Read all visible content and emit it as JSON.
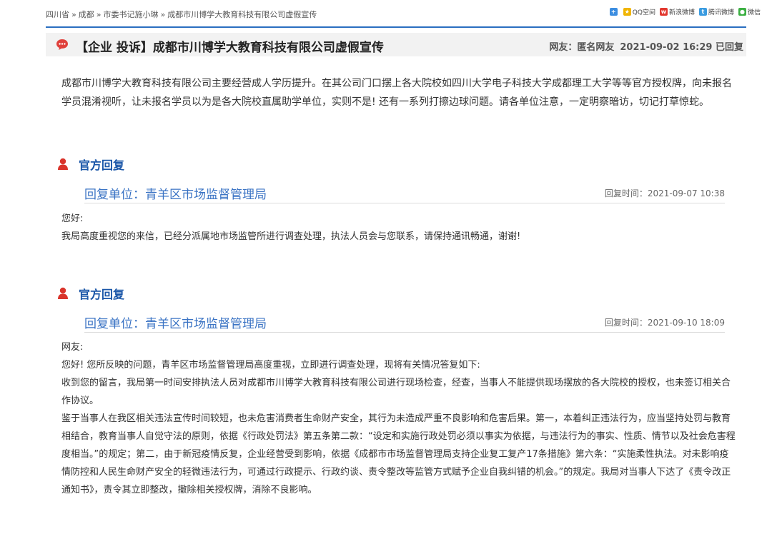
{
  "breadcrumb": [
    "四川省",
    "成都",
    "市委书记施小琳",
    "成都市川博学大教育科技有限公司虚假宣传"
  ],
  "breadcrumb_sep": "»",
  "share": {
    "qzone": "QQ空间",
    "weibo": "新浪微博",
    "tencent": "腾讯微博",
    "wechat": "微信"
  },
  "post": {
    "title": "【企业 投诉】成都市川博学大教育科技有限公司虚假宣传",
    "author": "网友：匿名网友",
    "datetime": "2021-09-02 16:29",
    "status": "已回复",
    "content": "成都市川博学大教育科技有限公司主要经营成人学历提升。在其公司门口摆上各大院校如四川大学电子科技大学成都理工大学等等官方授权牌，向未报名学员混淆视听，让未报名学员以为是各大院校直属助学单位，实则不是! 还有一系列打擦边球问题。请各单位注意，一定明察暗访，切记打草惊蛇。"
  },
  "replies": [
    {
      "heading": "官方回复",
      "unit": "回复单位：青羊区市场监督管理局",
      "time": "回复时间：2021-09-07 10:38",
      "paragraphs": [
        "您好:",
        "我局高度重视您的来信，已经分派属地市场监管所进行调查处理，执法人员会与您联系，请保持通讯畅通，谢谢!"
      ]
    },
    {
      "heading": "官方回复",
      "unit": "回复单位：青羊区市场监督管理局",
      "time": "回复时间：2021-09-10 18:09",
      "paragraphs": [
        "网友:",
        "您好! 您所反映的问题，青羊区市场监督管理局高度重视，立即进行调查处理，现将有关情况答复如下:",
        "收到您的留言，我局第一时间安排执法人员对成都市川博学大教育科技有限公司进行现场检查，经查，当事人不能提供现场摆放的各大院校的授权，也未签订相关合作协议。",
        "鉴于当事人在我区相关违法宣传时间较短，也未危害消费者生命财产安全，其行为未造成严重不良影响和危害后果。第一，本着纠正违法行为，应当坚持处罚与教育相结合，教育当事人自觉守法的原则，依据《行政处罚法》第五条第二款：“设定和实施行政处罚必须以事实为依据，与违法行为的事实、性质、情节以及社会危害程度相当。”的规定；第二，由于新冠疫情反复，企业经营受到影响，依据《成都市市场监督管理局支持企业复工复产17条措施》第六条：“实施柔性执法。对未影响疫情防控和人民生命财产安全的轻微违法行为，可通过行政提示、行政约谈、责令整改等监管方式赋予企业自我纠错的机会。”的规定。我局对当事人下达了《责令改正通知书》，责令其立即整改，撤除相关授权牌，消除不良影响。"
      ]
    }
  ],
  "colors": {
    "accent_blue": "#2a6ec0",
    "unit_blue": "#3a73c4",
    "bubble_red": "#e0403b",
    "person_red": "#d9342b"
  }
}
